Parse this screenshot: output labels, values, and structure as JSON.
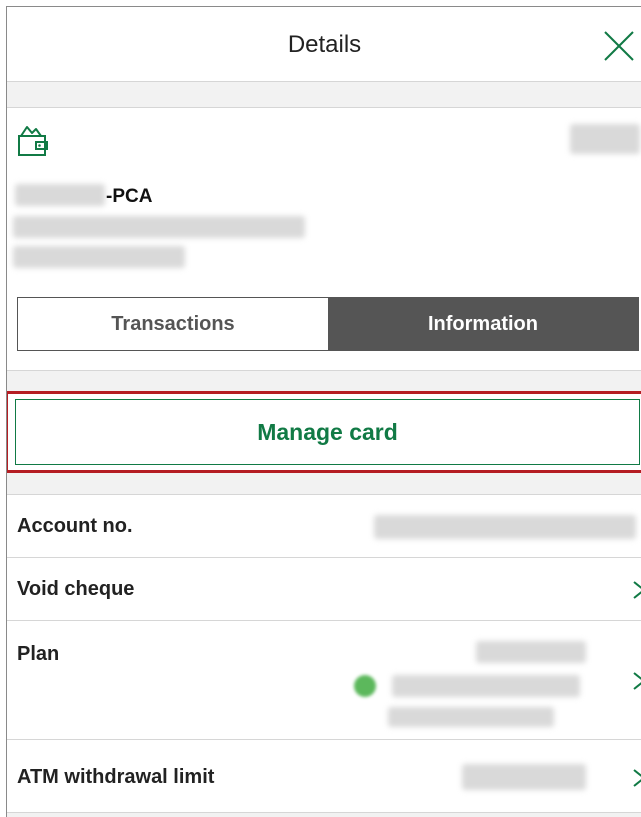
{
  "header": {
    "title": "Details",
    "close_icon": "close-icon"
  },
  "account": {
    "icon": "wallet-icon",
    "name_suffix": "-PCA"
  },
  "tabs": [
    {
      "label": "Transactions",
      "active": false
    },
    {
      "label": "Information",
      "active": true
    }
  ],
  "manage_card": {
    "label": "Manage card"
  },
  "info_rows": {
    "account_no": {
      "label": "Account no."
    },
    "void_cheque": {
      "label": "Void cheque"
    },
    "plan": {
      "label": "Plan",
      "status_color": "#5cb85c"
    },
    "atm_limit": {
      "label": "ATM withdrawal limit"
    }
  },
  "colors": {
    "brand_green": "#117a45",
    "highlight_red": "#b51d23",
    "segment_dark": "#555555"
  }
}
